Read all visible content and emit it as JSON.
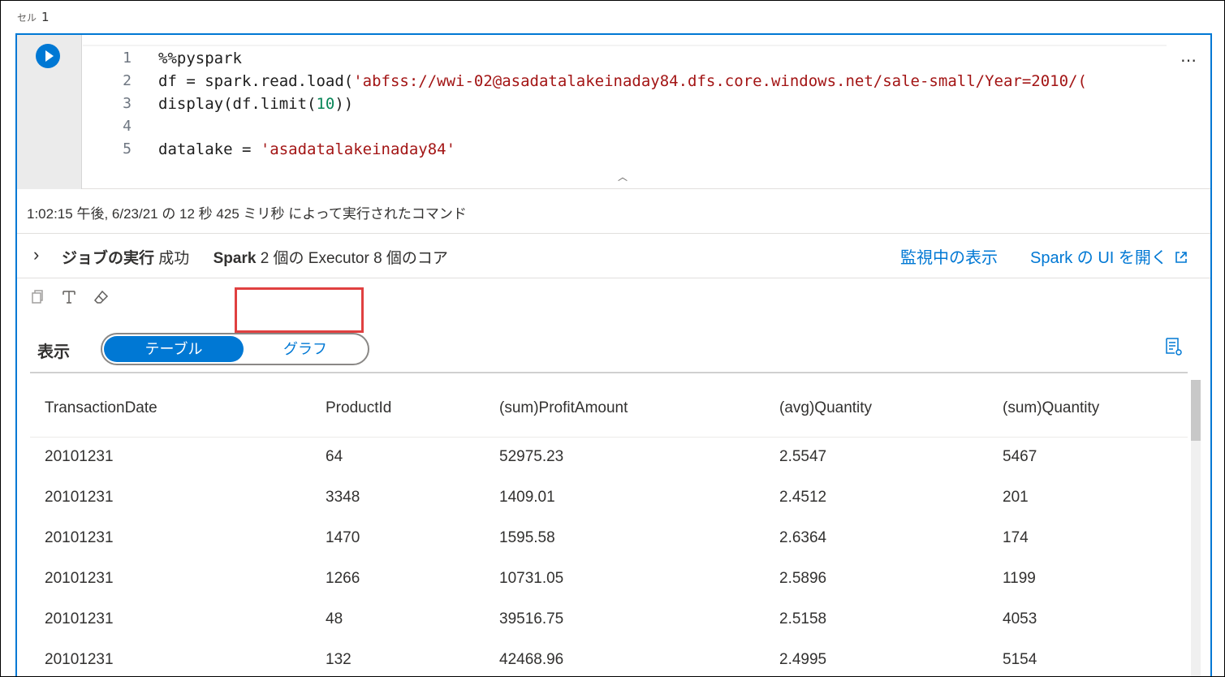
{
  "cell": {
    "label": "セル",
    "number": "1"
  },
  "editor": {
    "more_label": "…",
    "collapse_label": "︿",
    "lines": [
      {
        "n": "1",
        "parts": [
          {
            "t": "%%pyspark",
            "c": ""
          }
        ]
      },
      {
        "n": "2",
        "parts": [
          {
            "t": "df = spark.read.load(",
            "c": ""
          },
          {
            "t": "'abfss://wwi-02@asadatalakeinaday84.dfs.core.windows.net/sale-small/Year=2010/(",
            "c": "str"
          }
        ]
      },
      {
        "n": "3",
        "parts": [
          {
            "t": "display(df.limit(",
            "c": ""
          },
          {
            "t": "10",
            "c": "numc"
          },
          {
            "t": "))",
            "c": ""
          }
        ]
      },
      {
        "n": "4",
        "parts": [
          {
            "t": "",
            "c": ""
          }
        ]
      },
      {
        "n": "5",
        "parts": [
          {
            "t": "datalake = ",
            "c": ""
          },
          {
            "t": "'asadatalakeinaday84'",
            "c": "str"
          }
        ]
      }
    ]
  },
  "status": {
    "text": "1:02:15 午後, 6/23/21 の 12 秒 425 ミリ秒 によって実行されたコマンド"
  },
  "jobs": {
    "title": "ジョブの実行",
    "result": "成功",
    "spark_label": "Spark",
    "executor_text": "2 個の Executor 8 個のコア",
    "monitor_link": "監視中の表示",
    "spark_ui_link": "Spark の UI を開く"
  },
  "view": {
    "label": "表示",
    "table_option": "テーブル",
    "graph_option": "グラフ",
    "selected": "テーブル"
  },
  "table": {
    "columns": [
      "TransactionDate",
      "ProductId",
      "(sum)ProfitAmount",
      "(avg)Quantity",
      "(sum)Quantity"
    ],
    "rows": [
      [
        "20101231",
        "64",
        "52975.23",
        "2.5547",
        "5467"
      ],
      [
        "20101231",
        "3348",
        "1409.01",
        "2.4512",
        "201"
      ],
      [
        "20101231",
        "1470",
        "1595.58",
        "2.6364",
        "174"
      ],
      [
        "20101231",
        "1266",
        "10731.05",
        "2.5896",
        "1199"
      ],
      [
        "20101231",
        "48",
        "39516.75",
        "2.5158",
        "4053"
      ],
      [
        "20101231",
        "132",
        "42468.96",
        "2.4995",
        "5154"
      ]
    ]
  },
  "colors": {
    "accent": "#0078d4",
    "highlight": "#e04040",
    "string": "#a31515",
    "number": "#098658"
  }
}
